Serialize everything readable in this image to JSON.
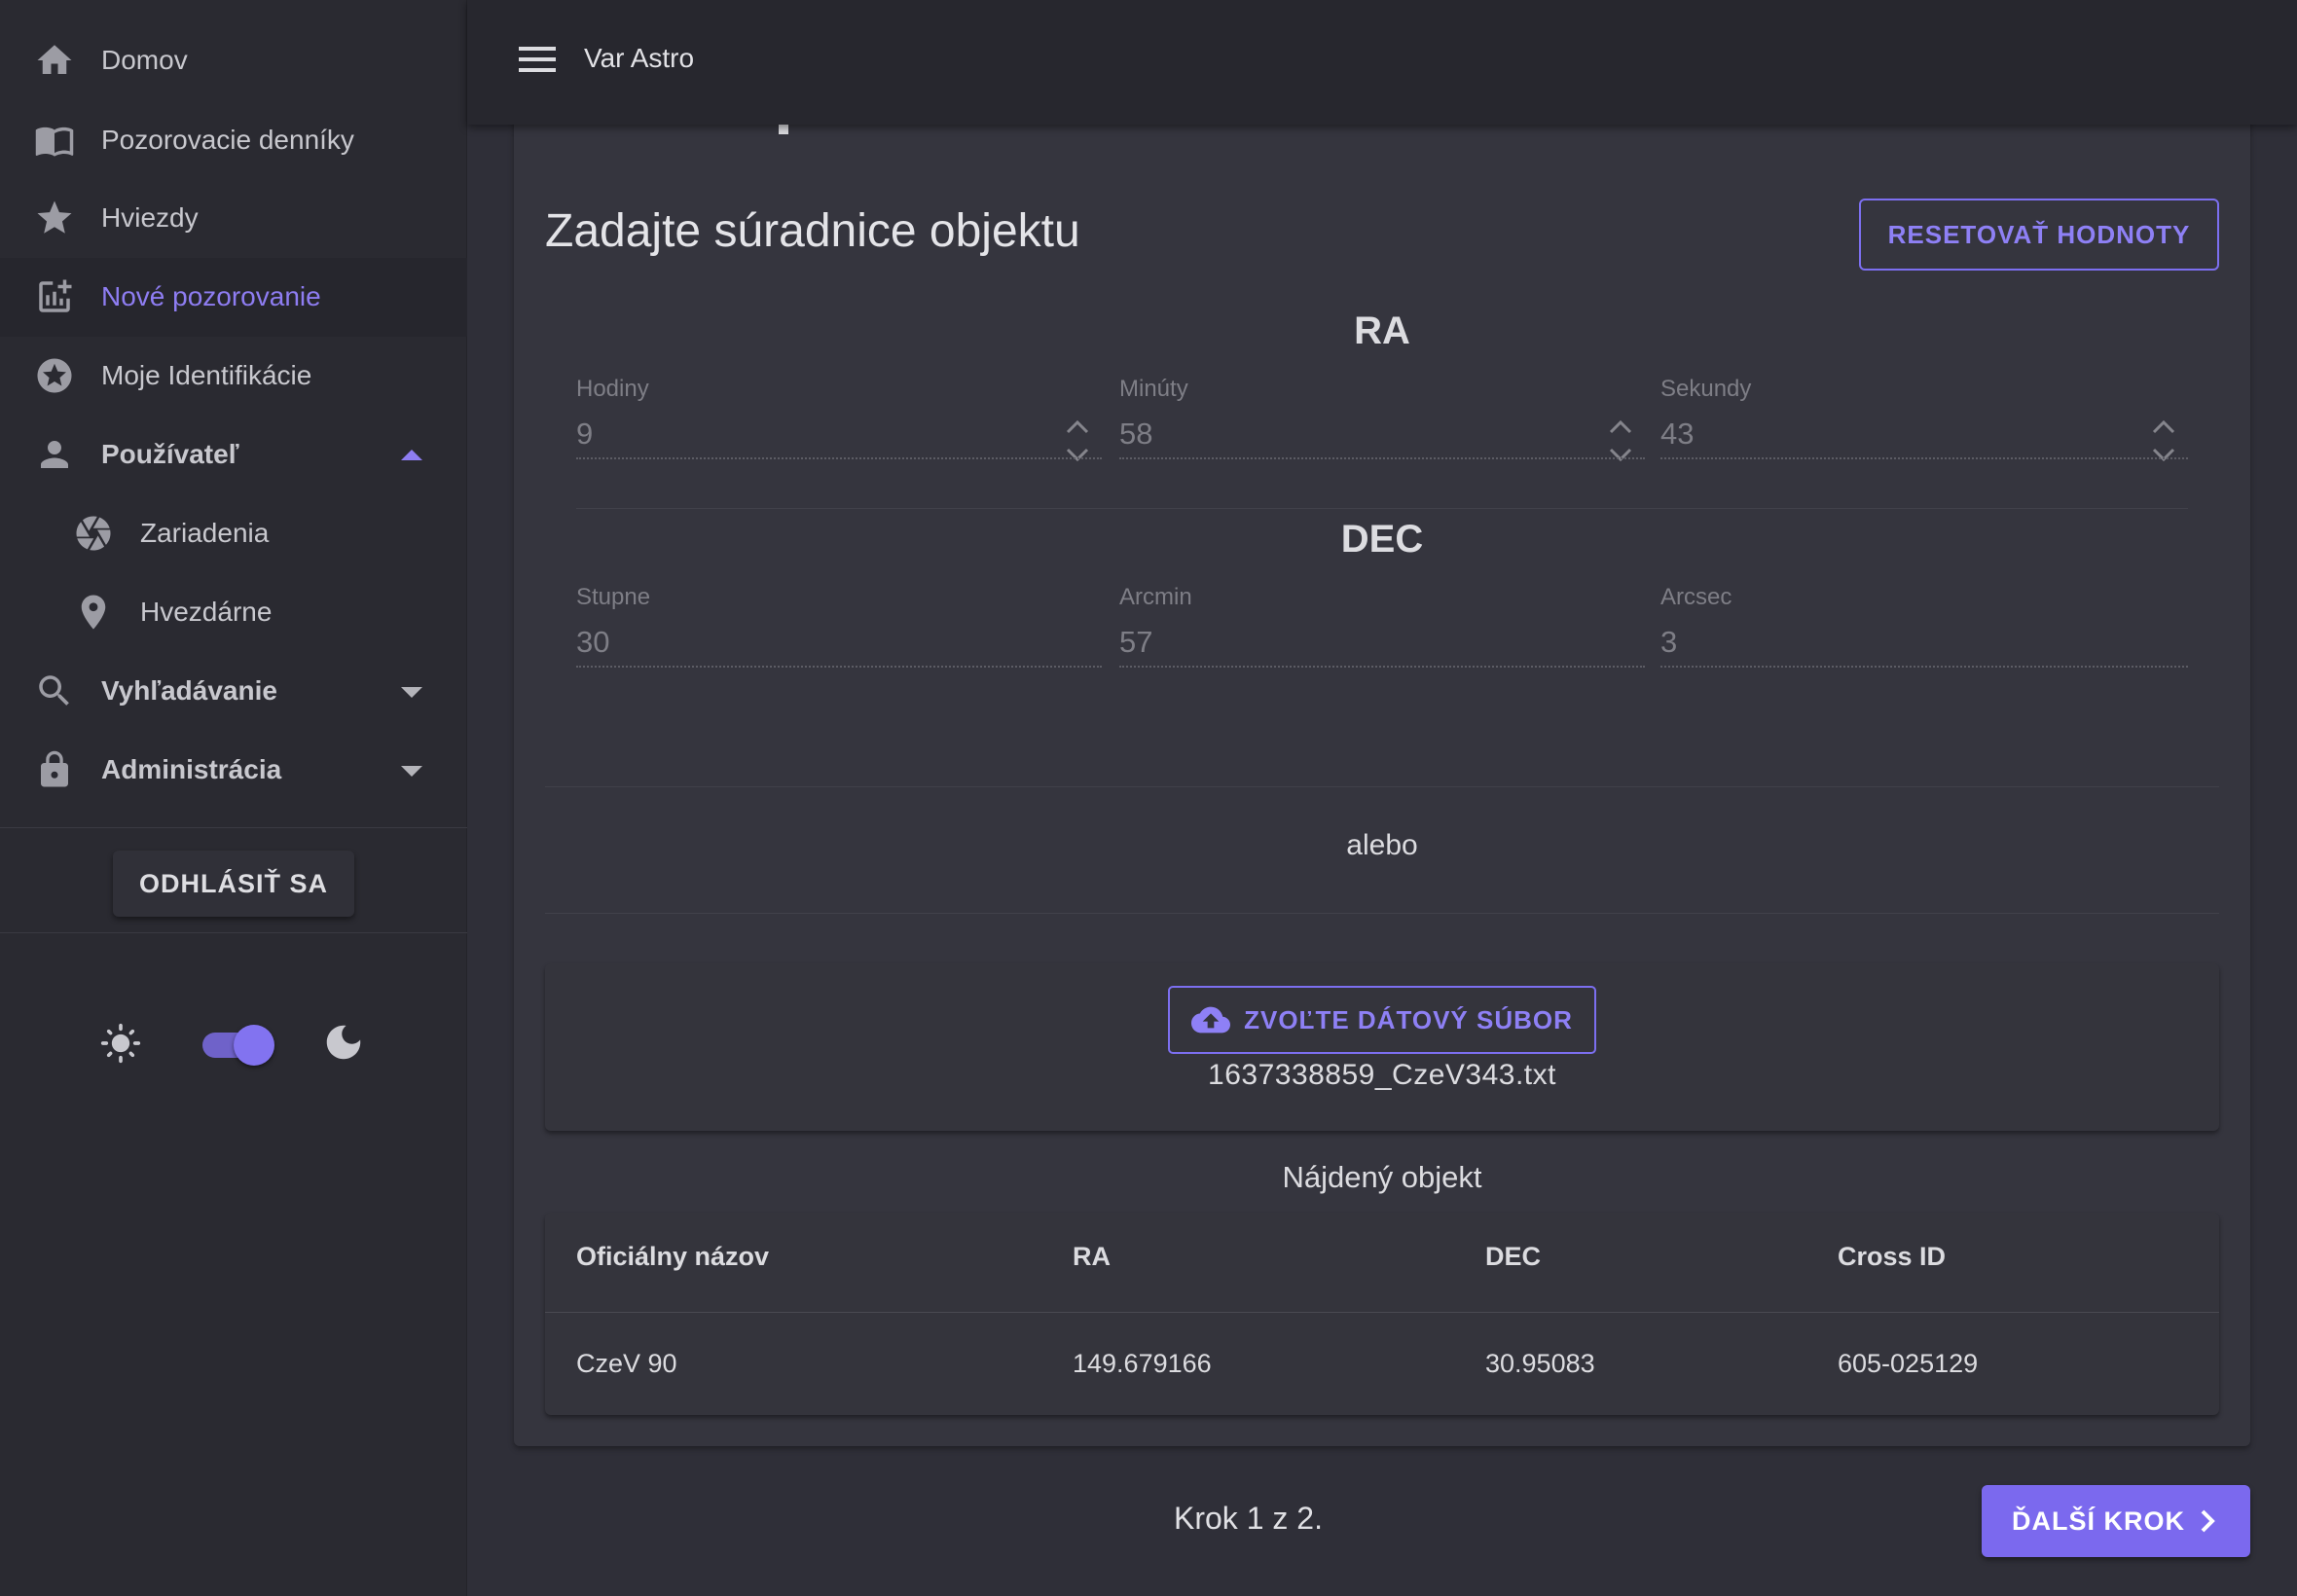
{
  "app": {
    "title": "Var Astro"
  },
  "sidebar": {
    "items": [
      {
        "label": "Domov",
        "icon": "home-icon"
      },
      {
        "label": "Pozorovacie denníky",
        "icon": "book-icon"
      },
      {
        "label": "Hviezdy",
        "icon": "star-icon"
      },
      {
        "label": "Nové pozorovanie",
        "icon": "add-chart-icon",
        "active": true
      },
      {
        "label": "Moje Identifikácie",
        "icon": "stars-badge-icon"
      },
      {
        "label": "Používateľ",
        "icon": "person-icon",
        "expanded": true
      },
      {
        "label": "Zariadenia",
        "icon": "camera-shutter-icon"
      },
      {
        "label": "Hvezdárne",
        "icon": "location-pin-icon"
      },
      {
        "label": "Vyhľadávanie",
        "icon": "search-icon"
      },
      {
        "label": "Administrácia",
        "icon": "lock-icon"
      }
    ],
    "logout_label": "ODHLÁSIŤ SA",
    "theme": {
      "dark_mode": true
    }
  },
  "main": {
    "title": "Zadajte súradnice objektu",
    "reset_label": "RESETOVAŤ HODNOTY",
    "ra": {
      "heading": "RA",
      "hours": {
        "label": "Hodiny",
        "value": "9"
      },
      "minutes": {
        "label": "Minúty",
        "value": "58"
      },
      "seconds": {
        "label": "Sekundy",
        "value": "43"
      }
    },
    "dec": {
      "heading": "DEC",
      "degrees": {
        "label": "Stupne",
        "value": "30"
      },
      "arcmin": {
        "label": "Arcmin",
        "value": "57"
      },
      "arcsec": {
        "label": "Arcsec",
        "value": "3"
      }
    },
    "or_text": "alebo",
    "upload_label": "ZVOĽTE DÁTOVÝ SÚBOR",
    "file_name": "1637338859_CzeV343.txt",
    "found_title": "Nájdený objekt",
    "table": {
      "headers": [
        "Oficiálny názov",
        "RA",
        "DEC",
        "Cross ID"
      ],
      "rows": [
        [
          "CzeV 90",
          "149.679166",
          "30.95083",
          "605-025129"
        ]
      ]
    },
    "step_text": "Krok 1 z 2.",
    "next_label": "ĎALŠÍ KROK"
  },
  "colors": {
    "accent": "#7b69ee",
    "background": "#2f2f38",
    "sidebar": "#2a2a31",
    "card": "#35353e"
  }
}
